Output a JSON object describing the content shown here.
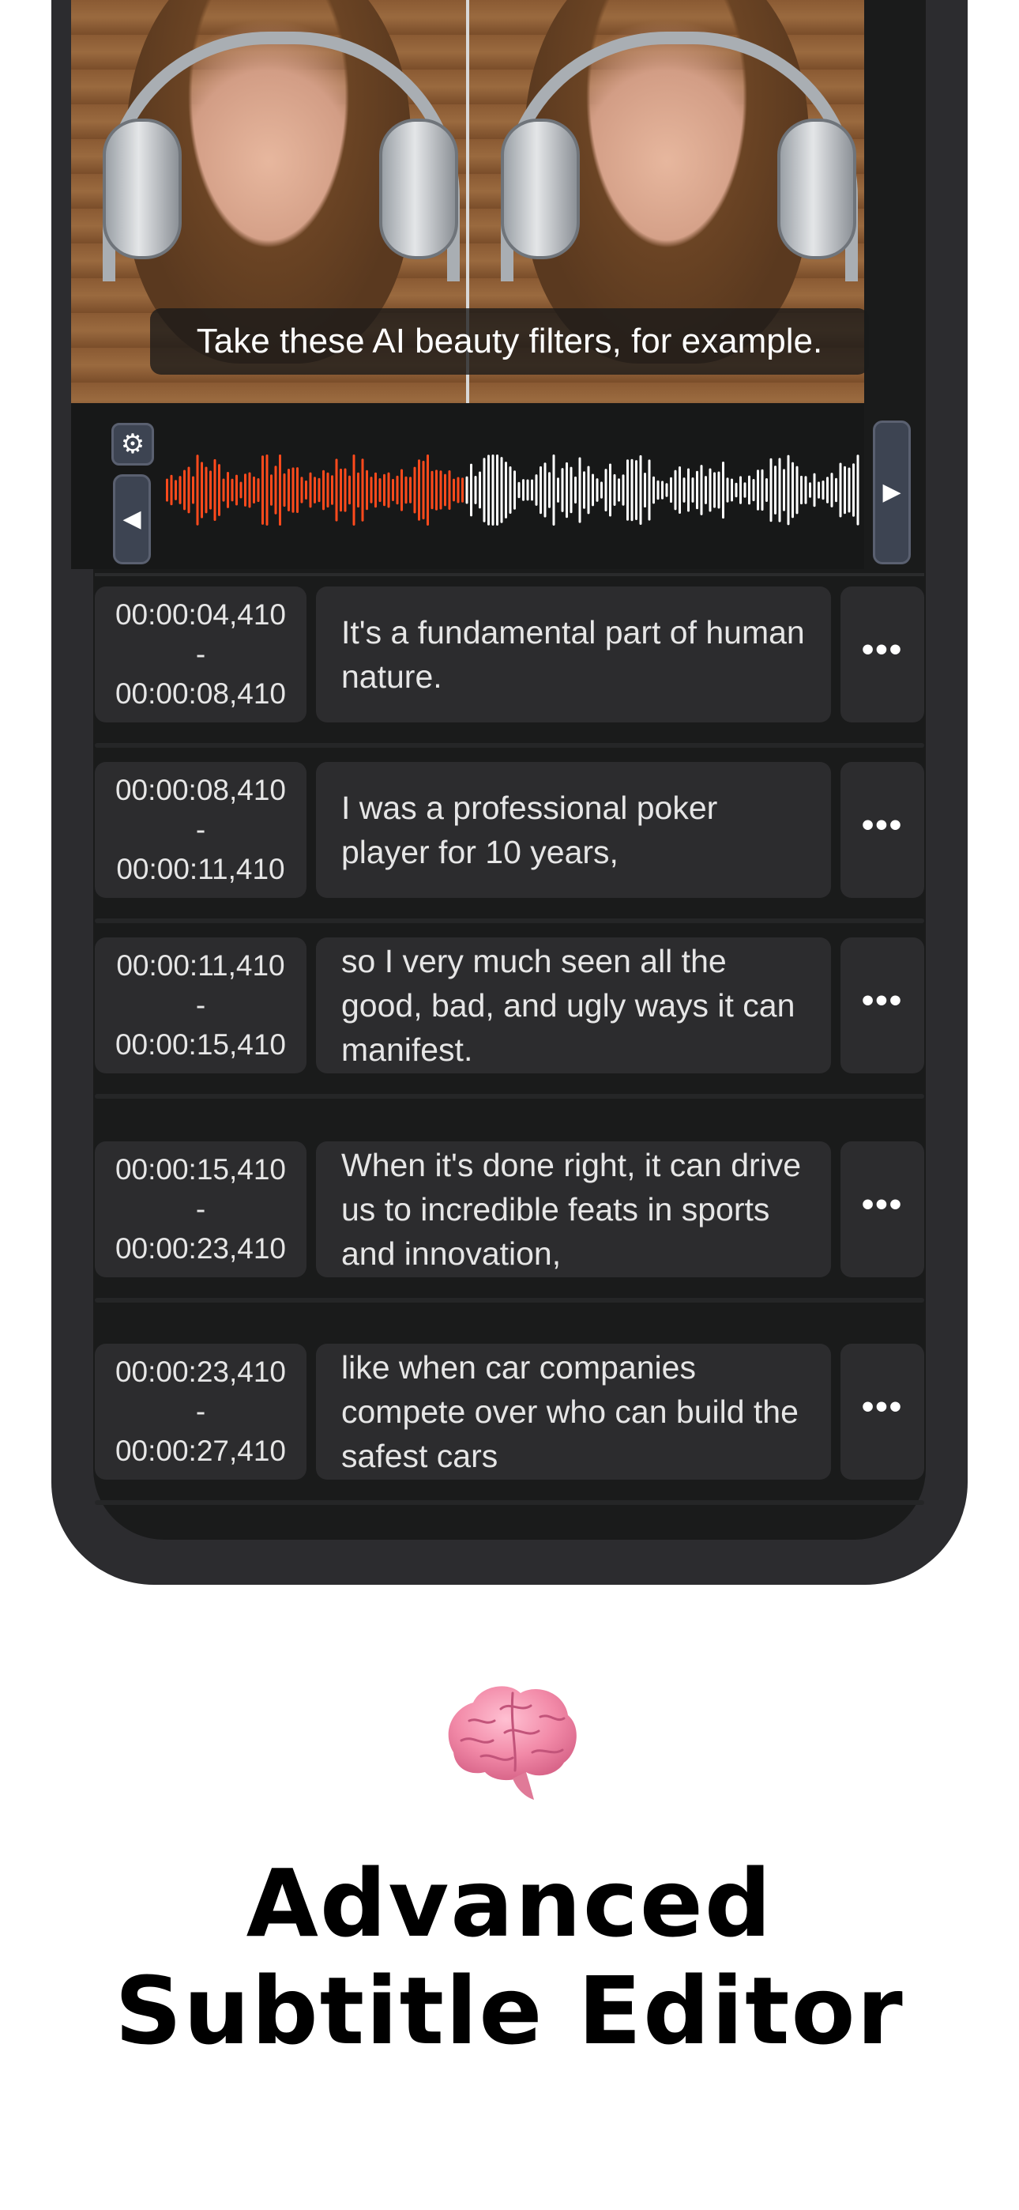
{
  "video": {
    "subtitle_overlay": "Take these AI beauty filters, for example."
  },
  "waveform": {
    "played_fraction": 0.43,
    "played_color": "#ff4a1c",
    "unplayed_color": "#ffffff"
  },
  "controls": {
    "settings_icon": "gear-icon",
    "prev_icon": "◀",
    "next_icon": "▶",
    "more_icon": "•••"
  },
  "subtitles": [
    {
      "start": "00:00:04,410",
      "sep": "-",
      "end": "00:00:08,410",
      "text": "It's a fundamental part of human nature."
    },
    {
      "start": "00:00:08,410",
      "sep": "-",
      "end": "00:00:11,410",
      "text": "I was a professional poker player for 10 years,"
    },
    {
      "start": "00:00:11,410",
      "sep": "-",
      "end": "00:00:15,410",
      "text": "so I very much seen all the good, bad, and ugly ways it can manifest."
    },
    {
      "start": "00:00:15,410",
      "sep": "-",
      "end": "00:00:23,410",
      "text": "When it's done right, it can drive us to incredible feats in sports and innovation,"
    },
    {
      "start": "00:00:23,410",
      "sep": "-",
      "end": "00:00:27,410",
      "text": "like when car companies compete over who can build the safest cars"
    }
  ],
  "marketing": {
    "emoji": "brain",
    "headline_line1": "Advanced",
    "headline_line2": "Subtitle Editor"
  }
}
